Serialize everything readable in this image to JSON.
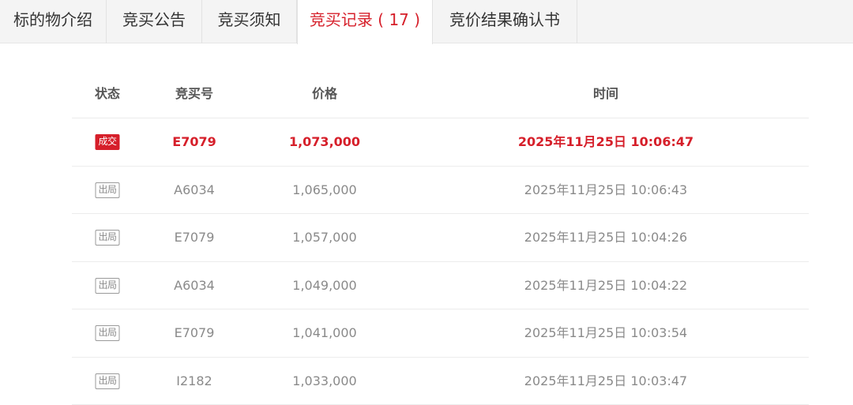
{
  "tabs": [
    {
      "label": "标的物介绍"
    },
    {
      "label": "竞买公告"
    },
    {
      "label": "竞买须知"
    },
    {
      "label": "竞买记录 ( 17 )"
    },
    {
      "label": "竞价结果确认书"
    }
  ],
  "table": {
    "headers": {
      "status": "状态",
      "bid_no": "竞买号",
      "price": "价格",
      "time": "时间"
    },
    "rows": [
      {
        "status": "成交",
        "bid_no": "E7079",
        "price": "1,073,000",
        "time": "2025年11月25日 10:06:47"
      },
      {
        "status": "出局",
        "bid_no": "A6034",
        "price": "1,065,000",
        "time": "2025年11月25日 10:06:43"
      },
      {
        "status": "出局",
        "bid_no": "E7079",
        "price": "1,057,000",
        "time": "2025年11月25日 10:04:26"
      },
      {
        "status": "出局",
        "bid_no": "A6034",
        "price": "1,049,000",
        "time": "2025年11月25日 10:04:22"
      },
      {
        "status": "出局",
        "bid_no": "E7079",
        "price": "1,041,000",
        "time": "2025年11月25日 10:03:54"
      },
      {
        "status": "出局",
        "bid_no": "I2182",
        "price": "1,033,000",
        "time": "2025年11月25日 10:03:47"
      }
    ]
  },
  "colors": {
    "accent": "#d61f2a",
    "muted_text": "#8a8a8a",
    "tab_bg": "#f4f4f4"
  }
}
